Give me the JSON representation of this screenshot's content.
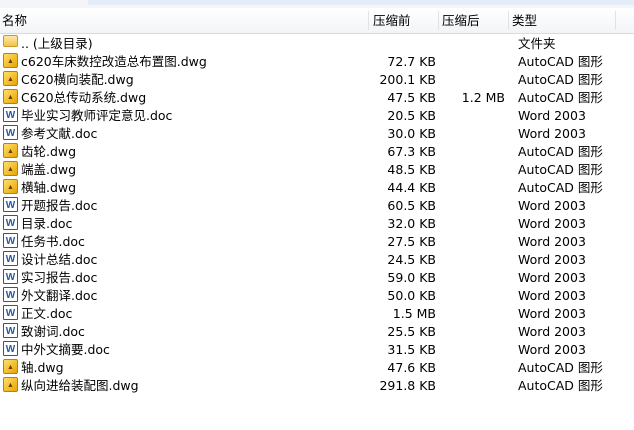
{
  "header": {
    "name": "名称",
    "compressed": "压缩前",
    "original": "压缩后",
    "type": "类型"
  },
  "parent": {
    "label": ".. (上级目录)",
    "type": "文件夹"
  },
  "files": [
    {
      "name": "c620车床数控改造总布置图.dwg",
      "icon": "dwg",
      "compressed": "72.7 KB",
      "original": "",
      "type": "AutoCAD 图形"
    },
    {
      "name": "C620横向装配.dwg",
      "icon": "dwg",
      "compressed": "200.1 KB",
      "original": "",
      "type": "AutoCAD 图形"
    },
    {
      "name": "C620总传动系统.dwg",
      "icon": "dwg",
      "compressed": "47.5 KB",
      "original": "1.2 MB",
      "type": "AutoCAD 图形"
    },
    {
      "name": "毕业实习教师评定意见.doc",
      "icon": "doc",
      "compressed": "20.5 KB",
      "original": "",
      "type": "Word 2003"
    },
    {
      "name": "参考文献.doc",
      "icon": "doc",
      "compressed": "30.0 KB",
      "original": "",
      "type": "Word 2003"
    },
    {
      "name": "齿轮.dwg",
      "icon": "dwg",
      "compressed": "67.3 KB",
      "original": "",
      "type": "AutoCAD 图形"
    },
    {
      "name": "端盖.dwg",
      "icon": "dwg",
      "compressed": "48.5 KB",
      "original": "",
      "type": "AutoCAD 图形"
    },
    {
      "name": "横轴.dwg",
      "icon": "dwg",
      "compressed": "44.4 KB",
      "original": "",
      "type": "AutoCAD 图形"
    },
    {
      "name": "开题报告.doc",
      "icon": "doc",
      "compressed": "60.5 KB",
      "original": "",
      "type": "Word 2003"
    },
    {
      "name": "目录.doc",
      "icon": "doc",
      "compressed": "32.0 KB",
      "original": "",
      "type": "Word 2003"
    },
    {
      "name": "任务书.doc",
      "icon": "doc",
      "compressed": "27.5 KB",
      "original": "",
      "type": "Word 2003"
    },
    {
      "name": "设计总结.doc",
      "icon": "doc",
      "compressed": "24.5 KB",
      "original": "",
      "type": "Word 2003"
    },
    {
      "name": "实习报告.doc",
      "icon": "doc",
      "compressed": "59.0 KB",
      "original": "",
      "type": "Word 2003"
    },
    {
      "name": "外文翻译.doc",
      "icon": "doc",
      "compressed": "50.0 KB",
      "original": "",
      "type": "Word 2003"
    },
    {
      "name": "正文.doc",
      "icon": "doc",
      "compressed": "1.5 MB",
      "original": "",
      "type": "Word 2003"
    },
    {
      "name": "致谢词.doc",
      "icon": "doc",
      "compressed": "25.5 KB",
      "original": "",
      "type": "Word 2003"
    },
    {
      "name": "中外文摘要.doc",
      "icon": "doc",
      "compressed": "31.5 KB",
      "original": "",
      "type": "Word 2003"
    },
    {
      "name": "轴.dwg",
      "icon": "dwg",
      "compressed": "47.6 KB",
      "original": "",
      "type": "AutoCAD 图形"
    },
    {
      "name": "纵向进给装配图.dwg",
      "icon": "dwg",
      "compressed": "291.8 KB",
      "original": "",
      "type": "AutoCAD 图形"
    }
  ]
}
